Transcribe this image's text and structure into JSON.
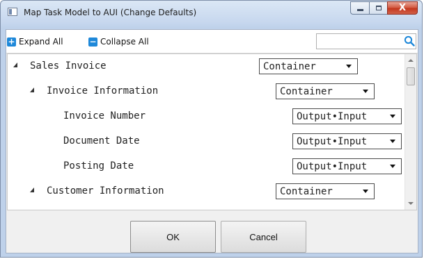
{
  "window": {
    "title": "Map Task Model to AUI (Change Defaults)",
    "close_glyph": "X",
    "icons": {
      "minimize": "minimize-icon",
      "maximize": "maximize-icon",
      "close": "close-icon",
      "app": "window-icon"
    }
  },
  "toolbar": {
    "expand_all": "Expand All",
    "collapse_all": "Collapse All",
    "expand_glyph": "+",
    "collapse_glyph": "−",
    "search": {
      "value": "",
      "icon": "search-icon",
      "icon_color": "#1e88d9"
    }
  },
  "tree": {
    "rows": [
      {
        "label": "Sales Invoice",
        "level": 0,
        "expanded": true,
        "select": "Container"
      },
      {
        "label": "Invoice Information",
        "level": 1,
        "expanded": true,
        "select": "Container"
      },
      {
        "label": "Invoice Number",
        "level": 2,
        "select": "Output•Input"
      },
      {
        "label": "Document Date",
        "level": 2,
        "select": "Output•Input"
      },
      {
        "label": "Posting Date",
        "level": 2,
        "select": "Output•Input"
      },
      {
        "label": "Customer Information",
        "level": 1,
        "expanded": true,
        "select": "Container"
      }
    ]
  },
  "buttons": {
    "ok": "OK",
    "cancel": "Cancel"
  },
  "colors": {
    "accent": "#1e88d9",
    "close_button": "#c2351d",
    "title_bar": "#c6d7ee"
  }
}
